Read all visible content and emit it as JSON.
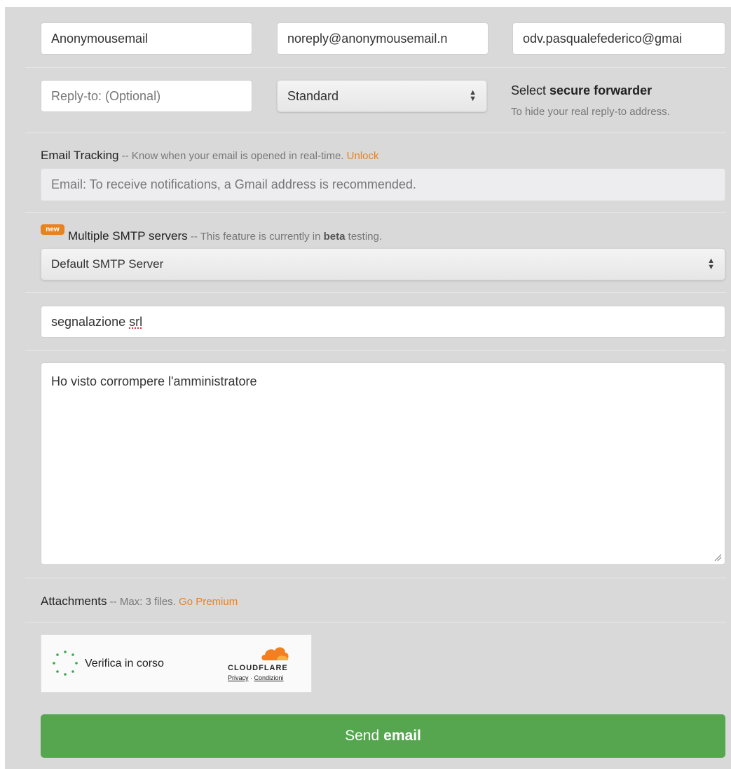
{
  "sender": {
    "name_value": "Anonymousemail",
    "from_value": "noreply@anonymousemail.n",
    "to_value": "odv.pasqualefederico@gmai"
  },
  "reply": {
    "placeholder": "Reply-to: (Optional)",
    "forwarder_selected": "Standard",
    "forwarder_title_prefix": "Select ",
    "forwarder_title_bold": "secure forwarder",
    "forwarder_hint": "To hide your real reply-to address."
  },
  "tracking": {
    "label": "Email Tracking",
    "note": " -- Know when your email is opened in real-time. ",
    "link": "Unlock",
    "placeholder": "Email: To receive notifications, a Gmail address is recommended."
  },
  "smtp": {
    "badge": "new",
    "label": "Multiple SMTP servers",
    "note_prefix": " -- This feature is currently in ",
    "note_bold": "beta",
    "note_suffix": " testing.",
    "selected": "Default SMTP Server"
  },
  "subject": {
    "value_word1": "segnalazione ",
    "value_word2": "srl"
  },
  "message": {
    "value": "Ho visto corrompere l'amministratore"
  },
  "attachments": {
    "label": "Attachments",
    "note": " -- Max: 3 files. ",
    "link": "Go Premium"
  },
  "captcha": {
    "status": "Verifica in corso",
    "brand": "CLOUDFLARE",
    "privacy": "Privacy",
    "separator": " · ",
    "terms": "Condizioni",
    "brand_color": "#f38020"
  },
  "send": {
    "prefix": "Send ",
    "bold": "email",
    "color": "#55a64e"
  }
}
